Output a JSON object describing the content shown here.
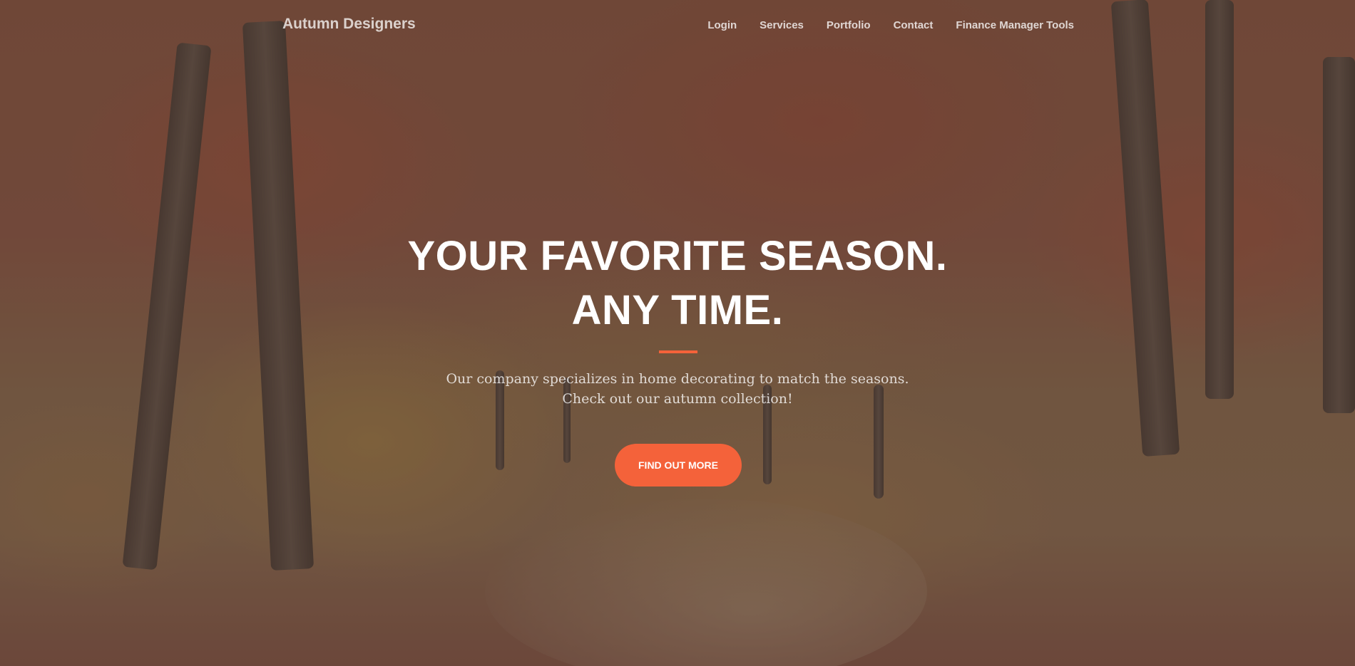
{
  "navbar": {
    "brand": "Autumn Designers",
    "links": [
      {
        "label": "Login"
      },
      {
        "label": "Services"
      },
      {
        "label": "Portfolio"
      },
      {
        "label": "Contact"
      },
      {
        "label": "Finance Manager Tools"
      }
    ]
  },
  "hero": {
    "title_line1": "YOUR FAVORITE SEASON.",
    "title_line2": "ANY TIME.",
    "text_line1": "Our company specializes in home decorating to match the seasons.",
    "text_line2": "Check out our autumn collection!",
    "cta_label": "FIND OUT MORE"
  },
  "colors": {
    "accent": "#f4623a",
    "text_primary": "#ffffff"
  }
}
